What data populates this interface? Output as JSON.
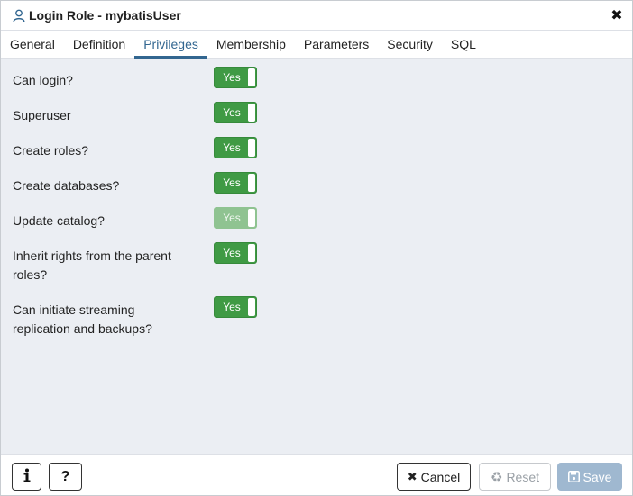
{
  "dialog": {
    "title": "Login Role - mybatisUser",
    "title_icon": "user-icon",
    "close_icon": "close-icon"
  },
  "tabs": [
    {
      "label": "General",
      "active": false
    },
    {
      "label": "Definition",
      "active": false
    },
    {
      "label": "Privileges",
      "active": true
    },
    {
      "label": "Membership",
      "active": false
    },
    {
      "label": "Parameters",
      "active": false
    },
    {
      "label": "Security",
      "active": false
    },
    {
      "label": "SQL",
      "active": false
    }
  ],
  "privileges": [
    {
      "label": "Can login?",
      "value": "Yes",
      "enabled": true
    },
    {
      "label": "Superuser",
      "value": "Yes",
      "enabled": true
    },
    {
      "label": "Create roles?",
      "value": "Yes",
      "enabled": true
    },
    {
      "label": "Create databases?",
      "value": "Yes",
      "enabled": true
    },
    {
      "label": "Update catalog?",
      "value": "Yes",
      "enabled": false
    },
    {
      "label": "Inherit rights from the parent roles?",
      "value": "Yes",
      "enabled": true
    },
    {
      "label": "Can initiate streaming replication and backups?",
      "value": "Yes",
      "enabled": true
    }
  ],
  "footer": {
    "info_icon": "info-icon",
    "help_icon": "question-icon",
    "cancel_label": "Cancel",
    "reset_label": "Reset",
    "save_label": "Save"
  },
  "colors": {
    "accent": "#326690",
    "toggle_on": "#3f9a44",
    "toggle_disabled": "#8fc391",
    "content_bg": "#ebeef3",
    "save_disabled": "#9fb8d0"
  }
}
